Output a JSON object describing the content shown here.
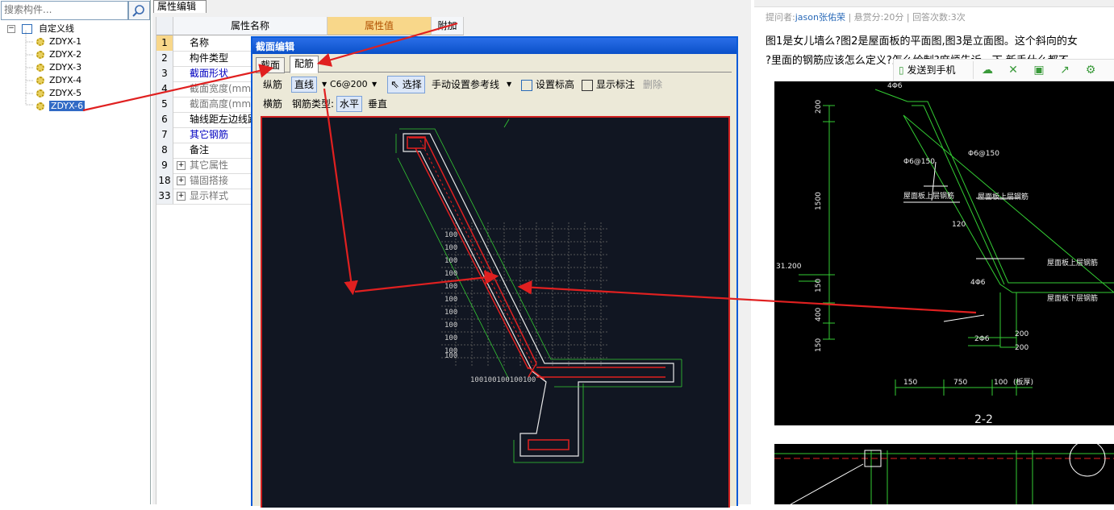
{
  "left_panel": {
    "search_placeholder": "搜索构件...",
    "root_label": "自定义线",
    "items": [
      {
        "label": "ZDYX-1"
      },
      {
        "label": "ZDYX-2"
      },
      {
        "label": "ZDYX-3"
      },
      {
        "label": "ZDYX-4"
      },
      {
        "label": "ZDYX-5"
      },
      {
        "label": "ZDYX-6",
        "selected": true
      }
    ]
  },
  "property_panel": {
    "tab_label": "属性编辑",
    "headers": {
      "name": "属性名称",
      "value": "属性值",
      "extra": "附加"
    },
    "rows": [
      {
        "num": "1",
        "name": "名称"
      },
      {
        "num": "2",
        "name": "构件类型"
      },
      {
        "num": "3",
        "name": "截面形状"
      },
      {
        "num": "4",
        "name": "截面宽度(mm)"
      },
      {
        "num": "5",
        "name": "截面高度(mm)"
      },
      {
        "num": "6",
        "name": "轴线距左边线距"
      },
      {
        "num": "7",
        "name": "其它钢筋"
      },
      {
        "num": "8",
        "name": "备注"
      },
      {
        "num": "9",
        "name": "其它属性",
        "expand": "+"
      },
      {
        "num": "18",
        "name": "锚固搭接",
        "expand": "+"
      },
      {
        "num": "33",
        "name": "显示样式",
        "expand": "+"
      }
    ]
  },
  "dialog": {
    "title": "截面编辑",
    "tabs": [
      "截面",
      "配筋"
    ],
    "toolbar1": {
      "longitudinal_label": "纵筋",
      "line_mode": "直线",
      "rebar_spec": "C6@200",
      "select_label": "选择",
      "manual_ref_label": "手动设置参考线",
      "set_elevation_label": "设置标高",
      "show_label": "显示标注",
      "delete_label": "删除"
    },
    "toolbar2": {
      "transverse_label": "横筋",
      "rebar_type_label": "钢筋类型:",
      "horizontal_label": "水平",
      "vertical_label": "垂直"
    }
  },
  "right_panel": {
    "asker_prefix": "提问者:",
    "asker": "jason张佑荣",
    "bounty": "悬赏分:20分",
    "answers": "回答次数:3次",
    "question_line1": "图1是女儿墙么?图2是屋面板的平面图,图3是立面图。这个斜向的女",
    "question_line2": "?里面的钢筋应该怎么定义?怎么绘制?麻烦告诉一下,新手什么都不",
    "send_to_phone": "发送到手机",
    "drawing_labels": {
      "d1": "Φ6@150",
      "d2": "Φ6@150",
      "d3": "屋面板上层钢筋",
      "d4": "屋面板上层钢筋",
      "d5": "120",
      "d6": "31.200",
      "d7": "屋面板上层钢筋",
      "d8": "屋面板下层钢筋",
      "d9": "4Φ6",
      "d10": "2Φ6",
      "d11": "200",
      "d12": "200",
      "d13": "150",
      "d14": "750",
      "d15": "100",
      "d16": "(板厚)",
      "d17": "2-2",
      "d18": "200",
      "d19": "1500",
      "d20": "150",
      "d21": "400",
      "d22": "150",
      "d23": "4Φ6"
    }
  },
  "colors": {
    "accent_red": "#e02020",
    "drawing_green": "#33cc33",
    "selection_blue": "#316ac5",
    "dialog_title": "#0a50c8"
  }
}
